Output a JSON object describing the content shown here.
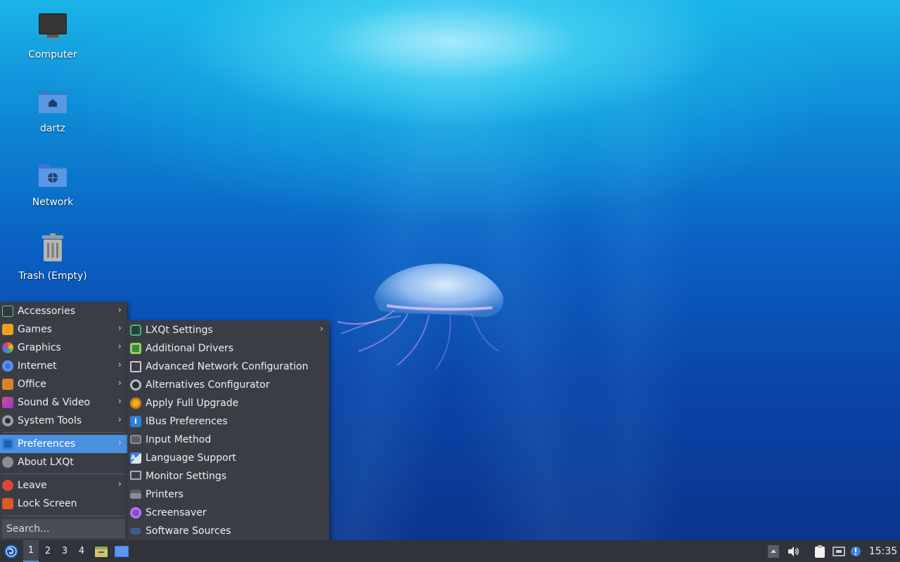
{
  "desktop": {
    "icons": [
      {
        "label": "Computer"
      },
      {
        "label": "dartz"
      },
      {
        "label": "Network"
      },
      {
        "label": "Trash (Empty)"
      }
    ]
  },
  "main_menu": {
    "items": [
      {
        "label": "Accessories",
        "icon": "accessories-icon",
        "color": "#4caf50"
      },
      {
        "label": "Games",
        "icon": "games-icon",
        "color": "#f0a020"
      },
      {
        "label": "Graphics",
        "icon": "graphics-icon",
        "color": "#e04a7a"
      },
      {
        "label": "Internet",
        "icon": "internet-icon",
        "color": "#3b6fe0"
      },
      {
        "label": "Office",
        "icon": "office-icon",
        "color": "#d9822b"
      },
      {
        "label": "Sound & Video",
        "icon": "sound-video-icon",
        "color": "#b03ad0"
      },
      {
        "label": "System Tools",
        "icon": "system-tools-icon",
        "color": "#9aa0a8"
      },
      {
        "label": "Preferences",
        "icon": "preferences-icon",
        "color": "#2d7fd8"
      },
      {
        "label": "About LXQt",
        "icon": "info-icon",
        "color": "#8a8d93"
      },
      {
        "label": "Leave",
        "icon": "power-icon",
        "color": "#e0453a"
      },
      {
        "label": "Lock Screen",
        "icon": "lock-icon",
        "color": "#e0572a"
      }
    ],
    "search_placeholder": "Search..."
  },
  "preferences_menu": {
    "items": [
      {
        "label": "LXQt Settings",
        "icon": "lxqt-settings-icon"
      },
      {
        "label": "Additional Drivers",
        "icon": "chip-icon"
      },
      {
        "label": "Advanced Network Configuration",
        "icon": "network-config-icon"
      },
      {
        "label": "Alternatives Configurator",
        "icon": "alternatives-icon"
      },
      {
        "label": "Apply Full Upgrade",
        "icon": "upgrade-icon"
      },
      {
        "label": "IBus Preferences",
        "icon": "ibus-icon"
      },
      {
        "label": "Input Method",
        "icon": "keyboard-icon"
      },
      {
        "label": "Language Support",
        "icon": "language-icon"
      },
      {
        "label": "Monitor Settings",
        "icon": "monitor-icon"
      },
      {
        "label": "Printers",
        "icon": "printer-icon"
      },
      {
        "label": "Screensaver",
        "icon": "screensaver-icon"
      },
      {
        "label": "Software Sources",
        "icon": "software-sources-icon"
      }
    ]
  },
  "taskbar": {
    "desktops": [
      "1",
      "2",
      "3",
      "4"
    ],
    "active_desktop": "1",
    "clock": "15:35"
  }
}
